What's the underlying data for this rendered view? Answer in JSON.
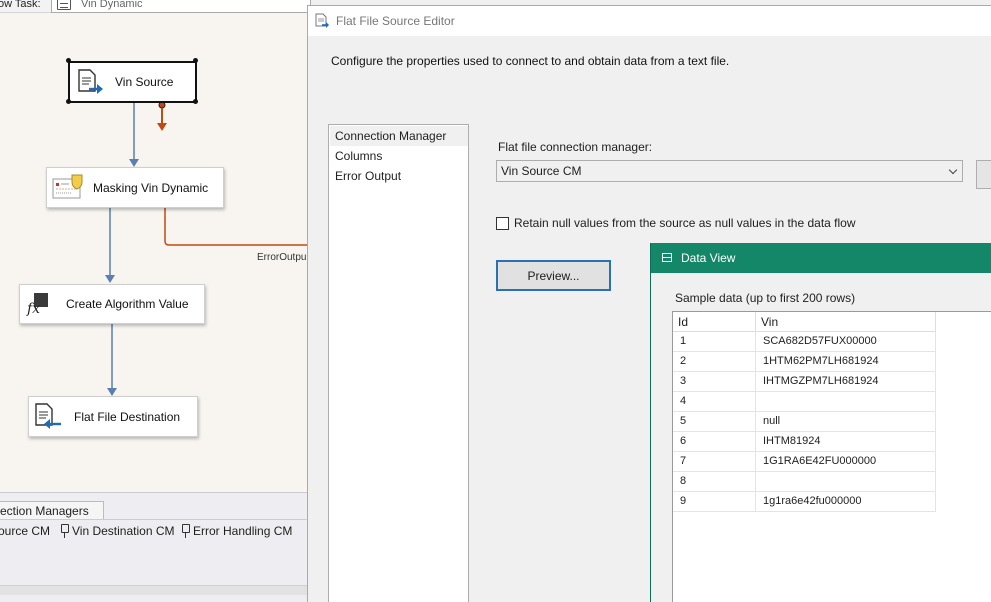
{
  "designer": {
    "task_label": "ow Task:",
    "task_value": "Vin Dynamic",
    "nodes": {
      "vin_source": "Vin Source",
      "masking": "Masking Vin Dynamic",
      "create_algo": "Create Algorithm Value",
      "flat_dest": "Flat File Destination"
    },
    "error_output_label": "ErrorOutpu",
    "connection_managers_tab": "ection Managers",
    "connection_managers": [
      "ource CM",
      "Vin Destination CM",
      "Error Handling CM"
    ]
  },
  "editor": {
    "title": "Flat File Source Editor",
    "description": "Configure the properties used to connect to and obtain data from a text file.",
    "nav": [
      "Connection Manager",
      "Columns",
      "Error Output"
    ],
    "active_nav": "Connection Manager",
    "cm_label": "Flat file connection manager:",
    "cm_value": "Vin Source CM",
    "retain_label": "Retain null values from the source as null values in the data flow",
    "retain_checked": false,
    "preview_label": "Preview..."
  },
  "dataview": {
    "title": "Data View",
    "sample_label": "Sample data (up to first 200 rows)",
    "columns": [
      "Id",
      "Vin"
    ],
    "rows": [
      [
        "1",
        "SCA682D57FUX00000"
      ],
      [
        "2",
        "1HTM62PM7LH681924"
      ],
      [
        "3",
        "IHTMGZPM7LH681924"
      ],
      [
        "4",
        ""
      ],
      [
        "5",
        "null"
      ],
      [
        "6",
        "IHTM81924"
      ],
      [
        "7",
        "1G1RA6E42FU000000"
      ],
      [
        "8",
        ""
      ],
      [
        "9",
        "1g1ra6e42fu000000"
      ]
    ]
  },
  "colors": {
    "dataview_title": "#148769",
    "error_path": "#c04a12",
    "flow_path": "#5b7fb0",
    "preview_border": "#2d6fb5"
  }
}
